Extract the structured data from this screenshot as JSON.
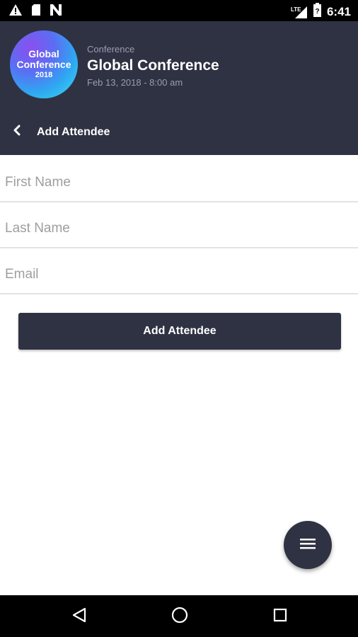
{
  "status_bar": {
    "time": "6:41",
    "network": "LTE",
    "icons": [
      "warning-icon",
      "sd-card-icon",
      "n-notification-icon",
      "signal-icon",
      "battery-icon"
    ]
  },
  "event": {
    "category": "Conference",
    "title": "Global Conference",
    "date": "Feb 13, 2018 - 8:00 am",
    "logo": {
      "line1": "Global",
      "line2": "Conference",
      "line3": "2018"
    }
  },
  "nav": {
    "back_icon": "chevron-left-icon",
    "title": "Add Attendee"
  },
  "form": {
    "first_name": {
      "placeholder": "First Name",
      "value": ""
    },
    "last_name": {
      "placeholder": "Last Name",
      "value": ""
    },
    "email": {
      "placeholder": "Email",
      "value": ""
    },
    "submit_label": "Add Attendee"
  },
  "fab": {
    "icon": "menu-icon"
  },
  "system_nav": {
    "icons": [
      "back-triangle-icon",
      "home-circle-icon",
      "recents-square-icon"
    ]
  },
  "colors": {
    "header_bg": "#2f3243",
    "button_bg": "#2f3243",
    "secondary_text": "#9a9db0"
  }
}
